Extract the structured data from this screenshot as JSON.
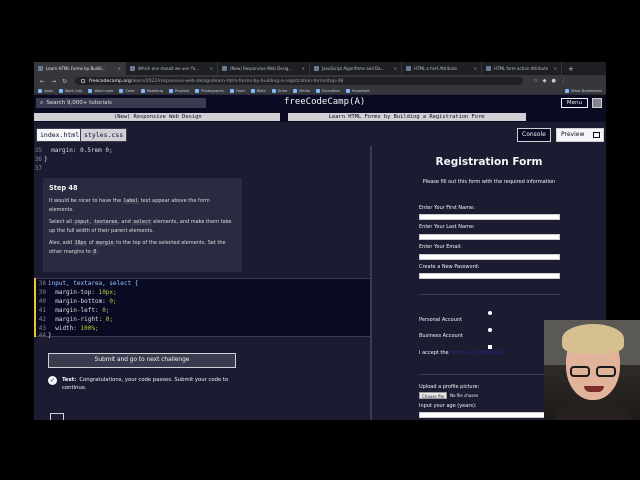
{
  "browser": {
    "tabs": [
      {
        "label": "Learn HTML Forms by Buildi...",
        "active": true
      },
      {
        "label": "Which one should we use 'fo...",
        "active": false
      },
      {
        "label": "(New) Responsive Web Desig...",
        "active": false
      },
      {
        "label": "JavaScript Algorithms and Da...",
        "active": false
      },
      {
        "label": "HTML a href Attribute",
        "active": false
      },
      {
        "label": "HTML form action Attribute",
        "active": false
      }
    ],
    "url_host": "freecodecamp.org",
    "url_path": "/learn/2022/responsive-web-design/learn-html-forms-by-building-a-registration-form/step-48",
    "bookmarks": [
      "Apps",
      "Work (ab)",
      "Work code",
      "Code",
      "Modeling",
      "Projects",
      "Photography",
      "Food",
      "Bible",
      "Drive",
      "Media",
      "Education",
      "Important"
    ],
    "other_bookmarks": "Other Bookmarks"
  },
  "header": {
    "search_placeholder": "Search 9,000+ tutorials",
    "brand": "freeCodeCamp(A)",
    "menu_label": "Menu"
  },
  "breadcrumbs": {
    "course": "(New) Responsive Web Design",
    "project": "Learn HTML Forms by Building a Registration Form"
  },
  "editor": {
    "tabs": [
      "index.html",
      "styles.css"
    ],
    "console_label": "Console",
    "preview_label": "Preview",
    "lines_top": [
      {
        "n": "35",
        "text": "  margin: 0.5rem 0;"
      },
      {
        "n": "36",
        "text": "}"
      },
      {
        "n": "37",
        "text": ""
      }
    ],
    "lines_active": [
      {
        "n": "38",
        "selector": "input, textarea, select {"
      },
      {
        "n": "39",
        "prop": "  margin-top:",
        "val": " 10px;"
      },
      {
        "n": "40",
        "prop": "  margin-bottom:",
        "val": " 0;"
      },
      {
        "n": "41",
        "prop": "  margin-left:",
        "val": " 0;"
      },
      {
        "n": "42",
        "prop": "  margin-right:",
        "val": " 0;"
      },
      {
        "n": "43",
        "prop": "  width:",
        "val": " 100%;"
      },
      {
        "n": "44",
        "text": "}"
      }
    ]
  },
  "hint": {
    "title": "Step 48",
    "p1_a": "It would be nicer to have the ",
    "p1_code": "label",
    "p1_b": " text appear above the form elements.",
    "p2_a": "Select all ",
    "p2_c1": "input",
    "p2_sep1": ", ",
    "p2_c2": "textarea",
    "p2_sep2": ", and ",
    "p2_c3": "select",
    "p2_b": " elements, and make them take up the full width of their parent elements.",
    "p3_a": "Also, add ",
    "p3_c1": "10px",
    "p3_b": " of ",
    "p3_c2": "margin",
    "p3_c": " to the top of the selected elements. Set the other margins to ",
    "p3_c3": "0",
    "p3_d": "."
  },
  "submit": {
    "label": "Submit and go to next challenge"
  },
  "test": {
    "label": "Test:",
    "message": "Congratulations, your code passes. Submit your code to continue."
  },
  "preview": {
    "title": "Registration Form",
    "subtitle": "Please fill out this form with the required information",
    "fields": [
      "Enter Your First Name:",
      "Enter Your Last Name:",
      "Enter Your Email:",
      "Create a New Password:"
    ],
    "account_options": [
      "Personal Account",
      "Business Account"
    ],
    "accept_prefix": "I accept the ",
    "accept_link": "terms and conditions",
    "upload_label": "Upload a profile picture:",
    "choose_file": "Choose file",
    "no_file": "No file chosen",
    "age_label": "Input your age (years):"
  },
  "colors": {
    "bg_dark": "#0a0a23",
    "bg_editor": "#1b1b32",
    "accent_yellow": "#f1be32",
    "code_blue": "#99c9ff",
    "code_green": "#acd157"
  }
}
